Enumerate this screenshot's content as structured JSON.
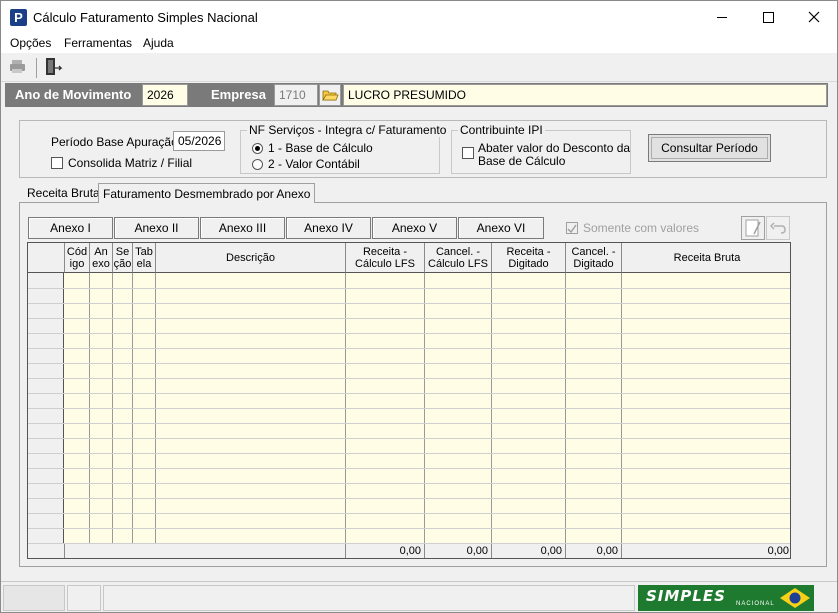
{
  "window": {
    "title": "Cálculo Faturamento Simples Nacional",
    "icon_letter": "P"
  },
  "menu": [
    "Opções",
    "Ferramentas",
    "Ajuda"
  ],
  "header": {
    "ano_label": "Ano de Movimento",
    "ano_value": "2026",
    "empresa_label": "Empresa",
    "empresa_code": "1710",
    "empresa_name": "LUCRO PRESUMIDO"
  },
  "filters": {
    "periodo_label": "Período Base Apuração:",
    "periodo_value": "05/2026",
    "consolida_label": "Consolida Matriz / Filial",
    "consolida_checked": false,
    "nf_group_title": "NF Serviços - Integra c/ Faturamento",
    "nf_options": [
      "1 -  Base de Cálculo",
      "2 -  Valor Contábil"
    ],
    "nf_selected": 0,
    "ipi_group_title": "Contribuinte IPI",
    "ipi_option_line1": "Abater valor do Desconto da",
    "ipi_option_line2": "Base de Cálculo",
    "ipi_checked": false,
    "consultar_button": "Consultar Período"
  },
  "tabs": [
    "Receita Bruta",
    "Faturamento Desmembrado por Anexo"
  ],
  "active_tab": 1,
  "annex_buttons": [
    "Anexo I",
    "Anexo II",
    "Anexo III",
    "Anexo IV",
    "Anexo V",
    "Anexo VI"
  ],
  "somente_label": "Somente com valores",
  "somente_checked": true,
  "grid": {
    "columns": [
      {
        "line1": "Cód",
        "line2": "igo"
      },
      {
        "line1": "An",
        "line2": "exo"
      },
      {
        "line1": "Se",
        "line2": "ção"
      },
      {
        "line1": "Tab",
        "line2": "ela"
      },
      {
        "line1": "Descrição",
        "line2": ""
      },
      {
        "line1": "Receita -",
        "line2": "Cálculo LFS"
      },
      {
        "line1": "Cancel. -",
        "line2": "Cálculo LFS"
      },
      {
        "line1": "Receita -",
        "line2": "Digitado"
      },
      {
        "line1": "Cancel. -",
        "line2": "Digitado"
      },
      {
        "line1": "Receita Bruta",
        "line2": ""
      }
    ],
    "totals": [
      "0,00",
      "0,00",
      "0,00",
      "0,00",
      "0,00"
    ]
  },
  "logo": {
    "text": "SIMPLES",
    "sub": "NACIONAL"
  },
  "colors": {
    "header_strip": "#7a7a7a",
    "grid_bg": "#fffde6",
    "logo_green": "#1e7a2e"
  }
}
